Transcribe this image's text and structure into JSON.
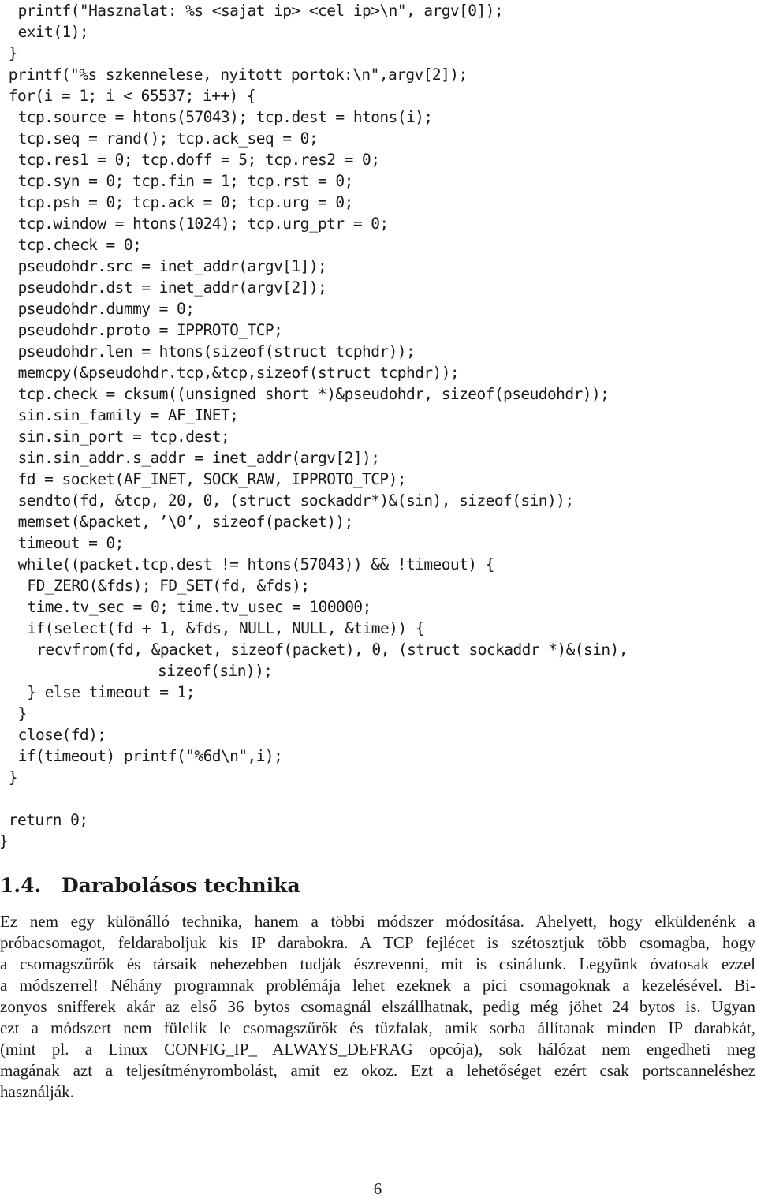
{
  "code": {
    "lines": [
      {
        "indent": 2,
        "text": "printf(\"Hasznalat: %s <sajat ip> <cel ip>\\n\", argv[0]);"
      },
      {
        "indent": 2,
        "text": "exit(1);"
      },
      {
        "indent": 1,
        "text": "}"
      },
      {
        "indent": 1,
        "text": "printf(\"%s szkennelese, nyitott portok:\\n\",argv[2]);"
      },
      {
        "indent": 1,
        "text": "for(i = 1; i < 65537; i++) {"
      },
      {
        "indent": 2,
        "text": "tcp.source = htons(57043); tcp.dest = htons(i);"
      },
      {
        "indent": 2,
        "text": "tcp.seq = rand(); tcp.ack_seq = 0;"
      },
      {
        "indent": 2,
        "text": "tcp.res1 = 0; tcp.doff = 5; tcp.res2 = 0;"
      },
      {
        "indent": 2,
        "text": "tcp.syn = 0; tcp.fin = 1; tcp.rst = 0;"
      },
      {
        "indent": 2,
        "text": "tcp.psh = 0; tcp.ack = 0; tcp.urg = 0;"
      },
      {
        "indent": 2,
        "text": "tcp.window = htons(1024); tcp.urg_ptr = 0;"
      },
      {
        "indent": 2,
        "text": "tcp.check = 0;"
      },
      {
        "indent": 2,
        "text": "pseudohdr.src = inet_addr(argv[1]);"
      },
      {
        "indent": 2,
        "text": "pseudohdr.dst = inet_addr(argv[2]);"
      },
      {
        "indent": 2,
        "text": "pseudohdr.dummy = 0;"
      },
      {
        "indent": 2,
        "text": "pseudohdr.proto = IPPROTO_TCP;"
      },
      {
        "indent": 2,
        "text": "pseudohdr.len = htons(sizeof(struct tcphdr));"
      },
      {
        "indent": 2,
        "text": "memcpy(&pseudohdr.tcp,&tcp,sizeof(struct tcphdr));"
      },
      {
        "indent": 2,
        "text": "tcp.check = cksum((unsigned short *)&pseudohdr, sizeof(pseudohdr));"
      },
      {
        "indent": 2,
        "text": "sin.sin_family = AF_INET;"
      },
      {
        "indent": 2,
        "text": "sin.sin_port = tcp.dest;"
      },
      {
        "indent": 2,
        "text": "sin.sin_addr.s_addr = inet_addr(argv[2]);"
      },
      {
        "indent": 2,
        "text": "fd = socket(AF_INET, SOCK_RAW, IPPROTO_TCP);"
      },
      {
        "indent": 2,
        "text": "sendto(fd, &tcp, 20, 0, (struct sockaddr*)&(sin), sizeof(sin));"
      },
      {
        "indent": 2,
        "text": "memset(&packet, ’\\0’, sizeof(packet));"
      },
      {
        "indent": 2,
        "text": "timeout = 0;"
      },
      {
        "indent": 2,
        "text": "while((packet.tcp.dest != htons(57043)) && !timeout) {"
      },
      {
        "indent": 3,
        "text": "FD_ZERO(&fds); FD_SET(fd, &fds);"
      },
      {
        "indent": 3,
        "text": "time.tv_sec = 0; time.tv_usec = 100000;"
      },
      {
        "indent": 3,
        "text": "if(select(fd + 1, &fds, NULL, NULL, &time)) {"
      },
      {
        "indent": 4,
        "text": "recvfrom(fd, &packet, sizeof(packet), 0, (struct sockaddr *)&(sin),"
      },
      {
        "indent": 8,
        "text": "sizeof(sin));"
      },
      {
        "indent": 3,
        "text": "} else timeout = 1;"
      },
      {
        "indent": 2,
        "text": "}"
      },
      {
        "indent": 2,
        "text": "close(fd);"
      },
      {
        "indent": 2,
        "text": "if(timeout) printf(\"%6d\\n\",i);"
      },
      {
        "indent": 1,
        "text": "}"
      },
      {
        "indent": 1,
        "text": ""
      },
      {
        "indent": 1,
        "text": "return 0;"
      },
      {
        "indent": 0,
        "text": "}"
      }
    ]
  },
  "section": {
    "number": "1.4.",
    "title": "Darabolásos technika"
  },
  "paragraph": {
    "lines": [
      "Ez nem egy különálló technika, hanem a többi módszer módosítása. Ahelyett, hogy elküldenénk a",
      "próbacsomagot, feldaraboljuk kis IP darabokra. A TCP fejlécet is szétosztjuk több csomagba, hogy",
      "a csomagszűrők és társaik nehezebben tudják észrevenni, mit is csinálunk. Legyünk óvatosak ezzel",
      "a módszerrel! Néhány programnak problémája lehet ezeknek a pici csomagoknak a kezelésével. Bi-",
      "zonyos snifferek akár az első 36 bytos csomagnál elszállhatnak, pedig még jöhet 24 bytos is. Ugyan",
      "ezt a módszert nem fülelik le csomagszűrők és tűzfalak, amik sorba állítanak minden IP darabkát,",
      "(mint pl. a Linux CONFIG_IP_ ALWAYS_DEFRAG opcója), sok hálózat nem engedheti meg",
      "magának azt a teljesítményrombolást, amit ez okoz. Ezt a lehetőséget ezért csak portscanneléshez",
      "használják."
    ]
  },
  "footer": {
    "page_number": "6"
  }
}
